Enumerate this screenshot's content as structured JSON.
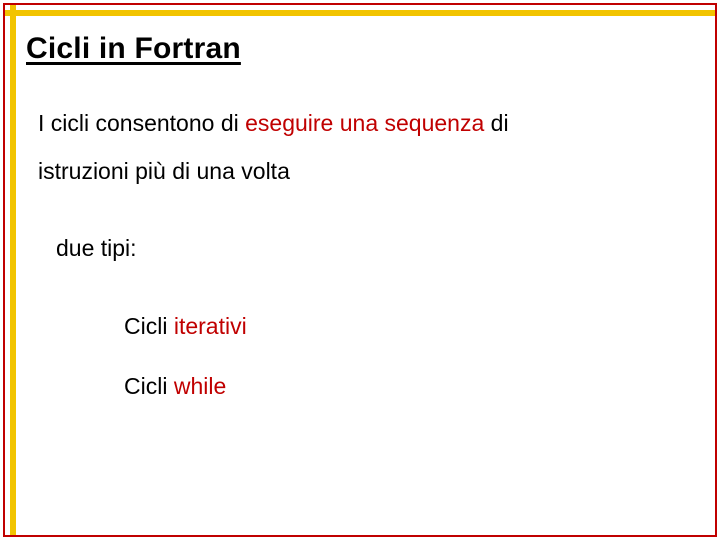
{
  "slide": {
    "title": "Cicli in Fortran",
    "line1_a": "I cicli consentono di  ",
    "line1_b": "eseguire una sequenza",
    "line1_c": " di",
    "line2": "istruzioni più di una volta",
    "line3": "due tipi:",
    "item1_a": "Cicli ",
    "item1_b": "iterativi",
    "item2_a": "Cicli ",
    "item2_b": "while"
  }
}
